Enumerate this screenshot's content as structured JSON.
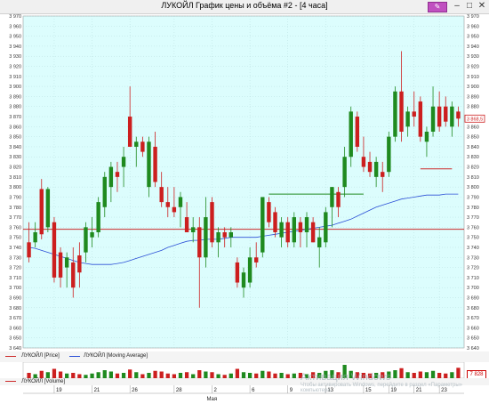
{
  "window": {
    "title": "ЛУКОЙЛ График цены и объёма #2 - [4 часа]",
    "minimize_icon": "minimize-icon",
    "maximize_icon": "maximize-icon",
    "close_icon": "close-icon",
    "pin_icon": "pencil-icon"
  },
  "colors": {
    "chart_bg": "#dcfdfd",
    "bull": "#1f8a1f",
    "bear": "#cc1f1f",
    "ma": "#2b4fd6",
    "level_line": "#cc2a2a",
    "green_line": "#1f8a1f"
  },
  "legend": {
    "price": "ЛУКОЙЛ [Price]",
    "ma": "ЛУКОЙЛ [Moving Average]",
    "volume": "ЛУКОЙЛ [Volume]"
  },
  "price_badge": "3 868,5",
  "volume_badge": "7 828",
  "watermark": {
    "title": "Активация Windows",
    "subtitle": "Чтобы активировать Windows, перейдите в раздел «Параметры» компьютера."
  },
  "time_axis": {
    "ticks": [
      {
        "label": "19"
      },
      {
        "label": "21"
      },
      {
        "label": "26"
      },
      {
        "label": "28"
      },
      {
        "label": "2"
      },
      {
        "label": "6"
      },
      {
        "label": "9"
      },
      {
        "label": "13"
      },
      {
        "label": "15"
      },
      {
        "label": "19"
      },
      {
        "label": "21"
      },
      {
        "label": "23"
      }
    ],
    "month_label": "Мая"
  },
  "chart_data": {
    "type": "candlestick",
    "y_range": [
      3640,
      3970
    ],
    "y_ticks": [
      "3 970",
      "3 960",
      "3 950",
      "3 940",
      "3 930",
      "3 920",
      "3 910",
      "3 900",
      "3 890",
      "3 880",
      "3 870",
      "3 860",
      "3 850",
      "3 840",
      "3 830",
      "3 820",
      "3 810",
      "3 800",
      "3 790",
      "3 780",
      "3 770",
      "3 760",
      "3 750",
      "3 740",
      "3 730",
      "3 720",
      "3 710",
      "3 700",
      "3 690",
      "3 680",
      "3 670",
      "3 660",
      "3 650",
      "3 640"
    ],
    "grid": true,
    "candles": [
      {
        "o": 3745,
        "h": 3765,
        "l": 3725,
        "c": 3730
      },
      {
        "o": 3745,
        "h": 3765,
        "l": 3740,
        "c": 3755
      },
      {
        "o": 3798,
        "h": 3808,
        "l": 3748,
        "c": 3753
      },
      {
        "o": 3760,
        "h": 3800,
        "l": 3755,
        "c": 3798
      },
      {
        "o": 3765,
        "h": 3770,
        "l": 3705,
        "c": 3710
      },
      {
        "o": 3735,
        "h": 3740,
        "l": 3700,
        "c": 3710
      },
      {
        "o": 3720,
        "h": 3735,
        "l": 3700,
        "c": 3730
      },
      {
        "o": 3725,
        "h": 3740,
        "l": 3690,
        "c": 3700
      },
      {
        "o": 3732,
        "h": 3745,
        "l": 3700,
        "c": 3715
      },
      {
        "o": 3735,
        "h": 3765,
        "l": 3725,
        "c": 3760
      },
      {
        "o": 3750,
        "h": 3770,
        "l": 3740,
        "c": 3755
      },
      {
        "o": 3755,
        "h": 3790,
        "l": 3750,
        "c": 3785
      },
      {
        "o": 3780,
        "h": 3815,
        "l": 3770,
        "c": 3810
      },
      {
        "o": 3800,
        "h": 3825,
        "l": 3785,
        "c": 3820
      },
      {
        "o": 3815,
        "h": 3825,
        "l": 3795,
        "c": 3810
      },
      {
        "o": 3820,
        "h": 3840,
        "l": 3800,
        "c": 3830
      },
      {
        "o": 3870,
        "h": 3900,
        "l": 3840,
        "c": 3840
      },
      {
        "o": 3840,
        "h": 3850,
        "l": 3820,
        "c": 3845
      },
      {
        "o": 3845,
        "h": 3850,
        "l": 3830,
        "c": 3835
      },
      {
        "o": 3800,
        "h": 3850,
        "l": 3790,
        "c": 3845
      },
      {
        "o": 3840,
        "h": 3855,
        "l": 3800,
        "c": 3805
      },
      {
        "o": 3800,
        "h": 3815,
        "l": 3780,
        "c": 3785
      },
      {
        "o": 3785,
        "h": 3800,
        "l": 3770,
        "c": 3780
      },
      {
        "o": 3780,
        "h": 3800,
        "l": 3770,
        "c": 3775
      },
      {
        "o": 3780,
        "h": 3795,
        "l": 3760,
        "c": 3790
      },
      {
        "o": 3770,
        "h": 3785,
        "l": 3755,
        "c": 3755
      },
      {
        "o": 3755,
        "h": 3770,
        "l": 3745,
        "c": 3760
      },
      {
        "o": 3760,
        "h": 3770,
        "l": 3680,
        "c": 3730
      },
      {
        "o": 3730,
        "h": 3790,
        "l": 3720,
        "c": 3770
      },
      {
        "o": 3785,
        "h": 3790,
        "l": 3740,
        "c": 3745
      },
      {
        "o": 3745,
        "h": 3760,
        "l": 3730,
        "c": 3755
      },
      {
        "o": 3755,
        "h": 3760,
        "l": 3740,
        "c": 3750
      },
      {
        "o": 3750,
        "h": 3760,
        "l": 3740,
        "c": 3755
      },
      {
        "o": 3725,
        "h": 3730,
        "l": 3700,
        "c": 3705
      },
      {
        "o": 3700,
        "h": 3720,
        "l": 3690,
        "c": 3715
      },
      {
        "o": 3705,
        "h": 3740,
        "l": 3700,
        "c": 3730
      },
      {
        "o": 3730,
        "h": 3745,
        "l": 3720,
        "c": 3725
      },
      {
        "o": 3735,
        "h": 3790,
        "l": 3730,
        "c": 3790
      },
      {
        "o": 3785,
        "h": 3790,
        "l": 3760,
        "c": 3765
      },
      {
        "o": 3775,
        "h": 3780,
        "l": 3750,
        "c": 3755
      },
      {
        "o": 3750,
        "h": 3770,
        "l": 3740,
        "c": 3765
      },
      {
        "o": 3765,
        "h": 3770,
        "l": 3740,
        "c": 3745
      },
      {
        "o": 3745,
        "h": 3775,
        "l": 3740,
        "c": 3770
      },
      {
        "o": 3765,
        "h": 3770,
        "l": 3740,
        "c": 3755
      },
      {
        "o": 3755,
        "h": 3775,
        "l": 3740,
        "c": 3770
      },
      {
        "o": 3765,
        "h": 3770,
        "l": 3745,
        "c": 3745
      },
      {
        "o": 3740,
        "h": 3760,
        "l": 3720,
        "c": 3750
      },
      {
        "o": 3745,
        "h": 3780,
        "l": 3740,
        "c": 3775
      },
      {
        "o": 3780,
        "h": 3800,
        "l": 3760,
        "c": 3800
      },
      {
        "o": 3795,
        "h": 3800,
        "l": 3770,
        "c": 3780
      },
      {
        "o": 3800,
        "h": 3840,
        "l": 3790,
        "c": 3830
      },
      {
        "o": 3830,
        "h": 3880,
        "l": 3820,
        "c": 3875
      },
      {
        "o": 3870,
        "h": 3875,
        "l": 3835,
        "c": 3840
      },
      {
        "o": 3830,
        "h": 3850,
        "l": 3815,
        "c": 3820
      },
      {
        "o": 3825,
        "h": 3835,
        "l": 3810,
        "c": 3815
      },
      {
        "o": 3810,
        "h": 3830,
        "l": 3800,
        "c": 3825
      },
      {
        "o": 3815,
        "h": 3825,
        "l": 3795,
        "c": 3810
      },
      {
        "o": 3815,
        "h": 3855,
        "l": 3810,
        "c": 3850
      },
      {
        "o": 3850,
        "h": 3900,
        "l": 3845,
        "c": 3895
      },
      {
        "o": 3895,
        "h": 3935,
        "l": 3845,
        "c": 3855
      },
      {
        "o": 3860,
        "h": 3880,
        "l": 3850,
        "c": 3875
      },
      {
        "o": 3875,
        "h": 3895,
        "l": 3860,
        "c": 3870
      },
      {
        "o": 3885,
        "h": 3890,
        "l": 3845,
        "c": 3850
      },
      {
        "o": 3845,
        "h": 3860,
        "l": 3830,
        "c": 3855
      },
      {
        "o": 3855,
        "h": 3900,
        "l": 3850,
        "c": 3880
      },
      {
        "o": 3880,
        "h": 3895,
        "l": 3855,
        "c": 3860
      },
      {
        "o": 3880,
        "h": 3890,
        "l": 3860,
        "c": 3865
      },
      {
        "o": 3860,
        "h": 3885,
        "l": 3850,
        "c": 3880
      },
      {
        "o": 3875,
        "h": 3880,
        "l": 3860,
        "c": 3868
      }
    ],
    "moving_average": [
      3740,
      3739,
      3737,
      3735,
      3733,
      3731,
      3729,
      3727,
      3725,
      3724,
      3723,
      3723,
      3723,
      3723,
      3724,
      3725,
      3727,
      3729,
      3731,
      3733,
      3735,
      3737,
      3740,
      3742,
      3744,
      3746,
      3747,
      3747,
      3748,
      3748,
      3748,
      3749,
      3750,
      3750,
      3750,
      3750,
      3750,
      3751,
      3752,
      3753,
      3754,
      3755,
      3756,
      3757,
      3758,
      3759,
      3760,
      3761,
      3762,
      3764,
      3766,
      3768,
      3771,
      3774,
      3777,
      3780,
      3782,
      3784,
      3786,
      3788,
      3789,
      3790,
      3791,
      3792,
      3792,
      3792,
      3793,
      3793,
      3793
    ],
    "horizontal_lines": [
      {
        "price": 3758,
        "color": "red",
        "span": "full"
      },
      {
        "price": 3793,
        "color": "green",
        "from_index": 38,
        "to_index": 53
      },
      {
        "price": 3818,
        "color": "red",
        "from_index": 62,
        "to_index": 67
      }
    ],
    "volume": [
      40,
      30,
      55,
      45,
      70,
      50,
      35,
      40,
      30,
      25,
      35,
      45,
      60,
      50,
      35,
      40,
      65,
      45,
      30,
      40,
      55,
      50,
      35,
      30,
      40,
      45,
      30,
      60,
      50,
      45,
      30,
      25,
      35,
      70,
      45,
      40,
      35,
      55,
      50,
      35,
      40,
      30,
      35,
      40,
      30,
      45,
      40,
      55,
      60,
      45,
      100,
      55,
      45,
      40,
      35,
      40,
      45,
      50,
      60,
      75,
      45,
      40,
      50,
      45,
      55,
      40,
      35,
      45,
      78
    ]
  }
}
